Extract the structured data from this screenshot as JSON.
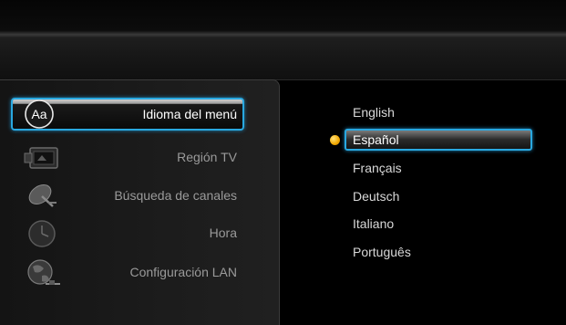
{
  "menu": {
    "items": [
      {
        "label": "Idioma del menú",
        "icon": "font-aa-icon",
        "icon_text": "Aa",
        "selected": true
      },
      {
        "label": "Región TV",
        "icon": "tv-screen-icon",
        "selected": false
      },
      {
        "label": "Búsqueda de canales",
        "icon": "satellite-dish-icon",
        "selected": false
      },
      {
        "label": "Hora",
        "icon": "clock-icon",
        "selected": false
      },
      {
        "label": "Configuración LAN",
        "icon": "network-globe-icon",
        "selected": false
      }
    ]
  },
  "languages": {
    "items": [
      {
        "label": "English",
        "selected": false
      },
      {
        "label": "Español",
        "selected": true
      },
      {
        "label": "Français",
        "selected": false
      },
      {
        "label": "Deutsch",
        "selected": false
      },
      {
        "label": "Italiano",
        "selected": false
      },
      {
        "label": "Português",
        "selected": false
      }
    ],
    "active_marker": "bullet-icon"
  },
  "colors": {
    "accent": "#29a8e0",
    "bullet": "#f2a800",
    "background": "#000000"
  }
}
